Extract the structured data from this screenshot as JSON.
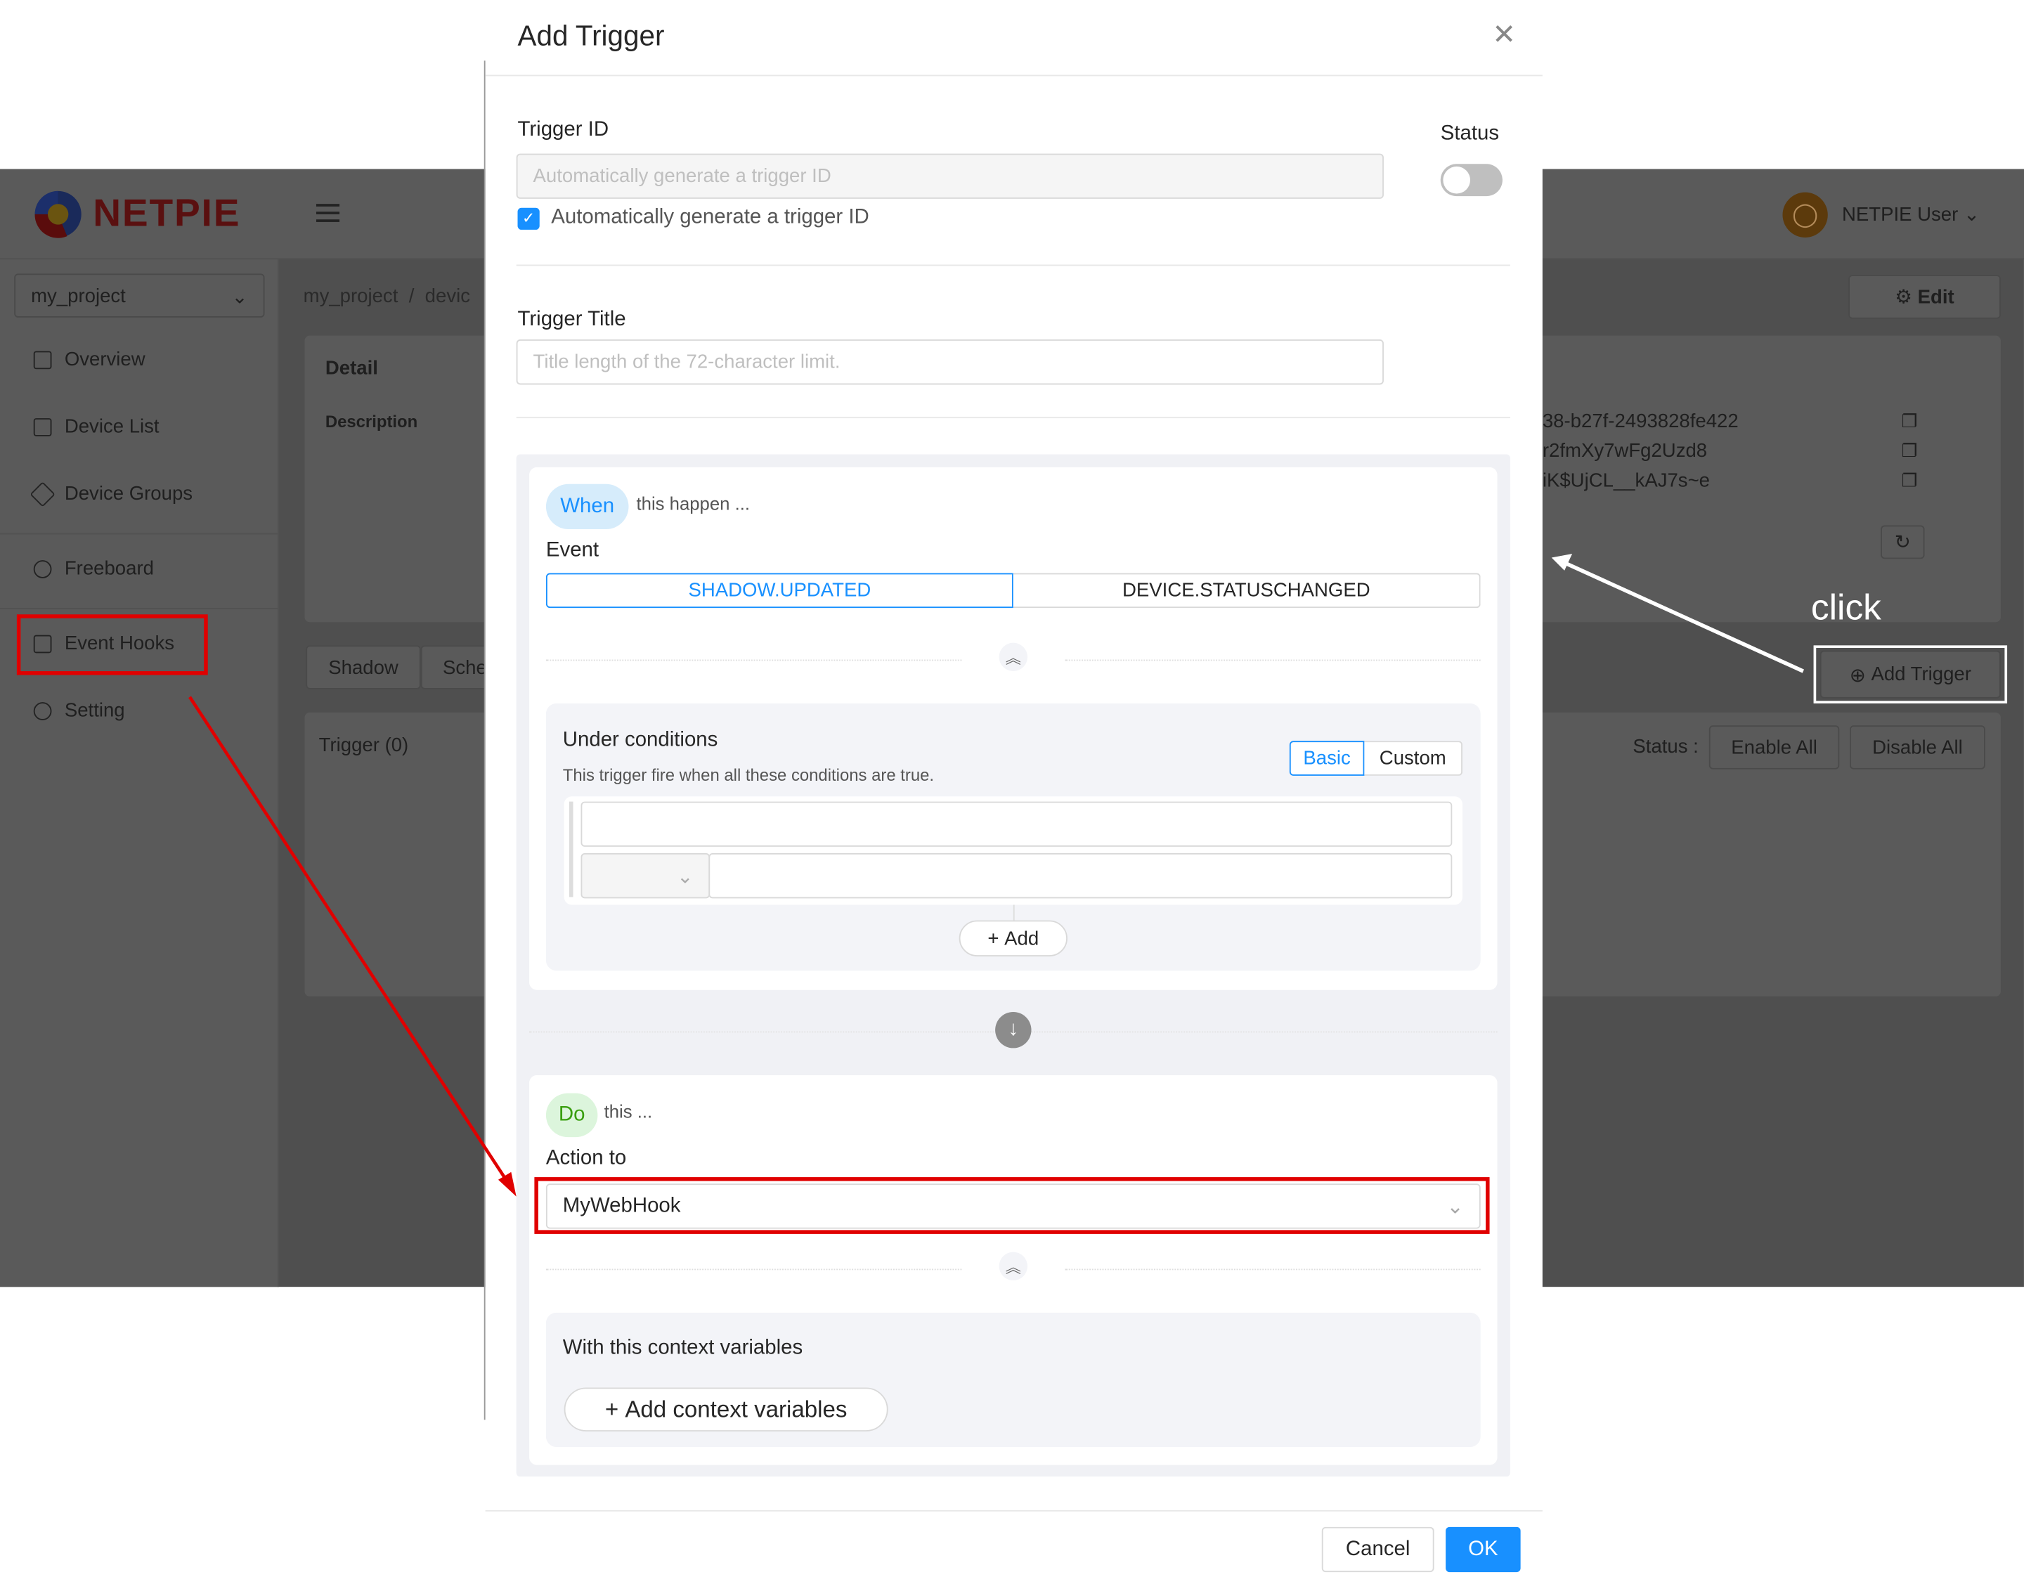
{
  "app": {
    "logo_text": "NETPIE",
    "project_select": "my_project",
    "breadcrumb": [
      "my_project",
      "/",
      "devic"
    ],
    "user_name": "NETPIE User",
    "edit_label": "Edit",
    "sidebar": [
      {
        "label": "Overview",
        "icon": "grid-icon"
      },
      {
        "label": "Device List",
        "icon": "device-list-icon"
      },
      {
        "label": "Device Groups",
        "icon": "tag-icon"
      },
      {
        "label": "Freeboard",
        "icon": "dashboard-icon"
      },
      {
        "label": "Event Hooks",
        "icon": "terminal-icon"
      },
      {
        "label": "Setting",
        "icon": "gear-icon"
      }
    ],
    "detail_title": "Detail",
    "description_label": "Description",
    "credentials": [
      "38-b27f-2493828fe422",
      "r2fmXy7wFg2Uzd8",
      "iK$UjCL__kAJ7s~e"
    ],
    "tabs": [
      "Shadow",
      "Sche"
    ],
    "trigger_count": "Trigger (0)",
    "add_trigger": "Add Trigger",
    "status_label": "Status :",
    "enable_all": "Enable All",
    "disable_all": "Disable All"
  },
  "annotation": {
    "click_text": "click",
    "color": "#e00000"
  },
  "modal": {
    "title": "Add Trigger",
    "trigger_id_label": "Trigger ID",
    "trigger_id_placeholder": "Automatically generate a trigger ID",
    "auto_generate_label": "Automatically generate a trigger ID",
    "auto_generate_checked": true,
    "status_label": "Status",
    "status_on": false,
    "trigger_title_label": "Trigger Title",
    "trigger_title_placeholder": "Title length of the 72-character limit.",
    "when": {
      "pill": "When",
      "text": "this happen ...",
      "event_label": "Event",
      "events": [
        "SHADOW.UPDATED",
        "DEVICE.STATUSCHANGED"
      ],
      "selected_event": "SHADOW.UPDATED",
      "conditions_title": "Under conditions",
      "conditions_desc": "This trigger fire when all these conditions are true.",
      "modes": [
        "Basic",
        "Custom"
      ],
      "selected_mode": "Basic",
      "add_label": "Add"
    },
    "do": {
      "pill": "Do",
      "text": "this ...",
      "action_label": "Action to",
      "action_value": "MyWebHook",
      "context_title": "With this context variables",
      "add_context_label": "Add context variables"
    },
    "cancel_label": "Cancel",
    "ok_label": "OK",
    "accent": "#1890ff"
  }
}
